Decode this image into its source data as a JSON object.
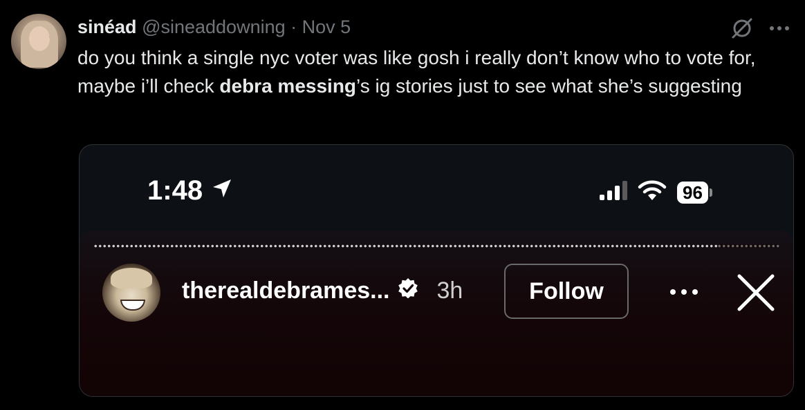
{
  "tweet": {
    "display_name": "sinéad",
    "handle": "@sineaddowning",
    "separator": "·",
    "date": "Nov 5",
    "text_part1": "do you think a single nyc voter was like gosh i really don’t know who to vote for, maybe i’ll check ",
    "text_bold": "debra messing",
    "text_part2": "’s ig stories just to see what she’s suggesting",
    "icons": [
      "grok-icon",
      "more-icon"
    ]
  },
  "media": {
    "status_bar": {
      "time": "1:48",
      "battery": "96",
      "icons": [
        "location-arrow-icon",
        "signal-icon",
        "wifi-icon",
        "battery-icon"
      ]
    },
    "story": {
      "username": "therealdebrames...",
      "timestamp": "3h",
      "follow_label": "Follow",
      "icons": [
        "verified-badge-icon",
        "more-icon",
        "close-icon"
      ]
    }
  },
  "colors": {
    "background": "#000000",
    "text": "#e7e9ea",
    "muted": "#71767b",
    "media_border": "#2f3336",
    "story_bg": "#140709"
  }
}
